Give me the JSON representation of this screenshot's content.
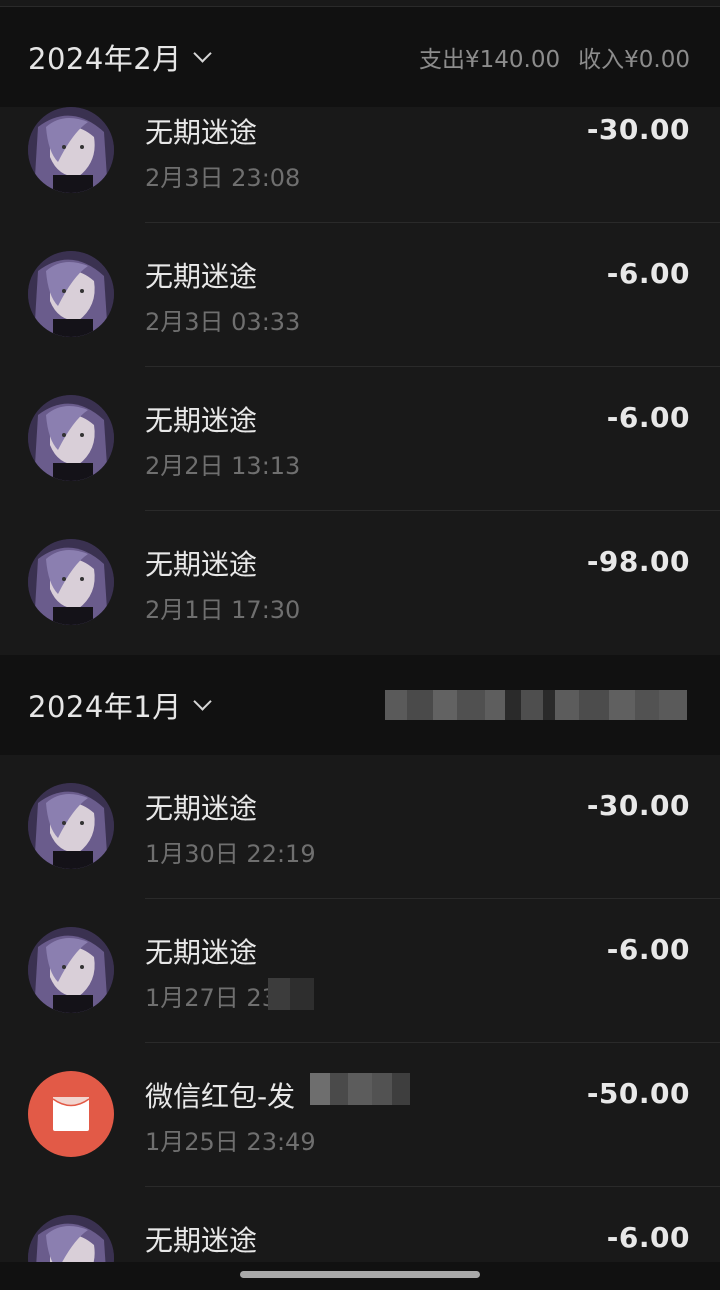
{
  "sections": [
    {
      "month": "2024年2月",
      "summary": {
        "expense": "支出¥140.00",
        "income": "收入¥0.00"
      },
      "rows": [
        {
          "title": "无期迷途",
          "time": "2月3日 23:08",
          "amount": "-30.00",
          "icon": "avatar"
        },
        {
          "title": "无期迷途",
          "time": "2月3日 03:33",
          "amount": "-6.00",
          "icon": "avatar"
        },
        {
          "title": "无期迷途",
          "time": "2月2日 13:13",
          "amount": "-6.00",
          "icon": "avatar"
        },
        {
          "title": "无期迷途",
          "time": "2月1日 17:30",
          "amount": "-98.00",
          "icon": "avatar"
        }
      ]
    },
    {
      "month": "2024年1月",
      "summary_redacted": true,
      "rows": [
        {
          "title": "无期迷途",
          "time": "1月30日 22:19",
          "amount": "-30.00",
          "icon": "avatar"
        },
        {
          "title": "无期迷途",
          "time": "1月27日 23",
          "amount": "-6.00",
          "icon": "avatar"
        },
        {
          "title": "微信红包-发",
          "time": "1月25日 23:49",
          "amount": "-50.00",
          "icon": "red-packet-icon"
        },
        {
          "title": "无期迷途",
          "time": "",
          "amount": "-6.00",
          "icon": "avatar"
        }
      ]
    }
  ],
  "colors": {
    "background": "#191919",
    "header": "#111111",
    "red_packet": "#e25a47",
    "secondary_text": "#6f6f6f"
  }
}
